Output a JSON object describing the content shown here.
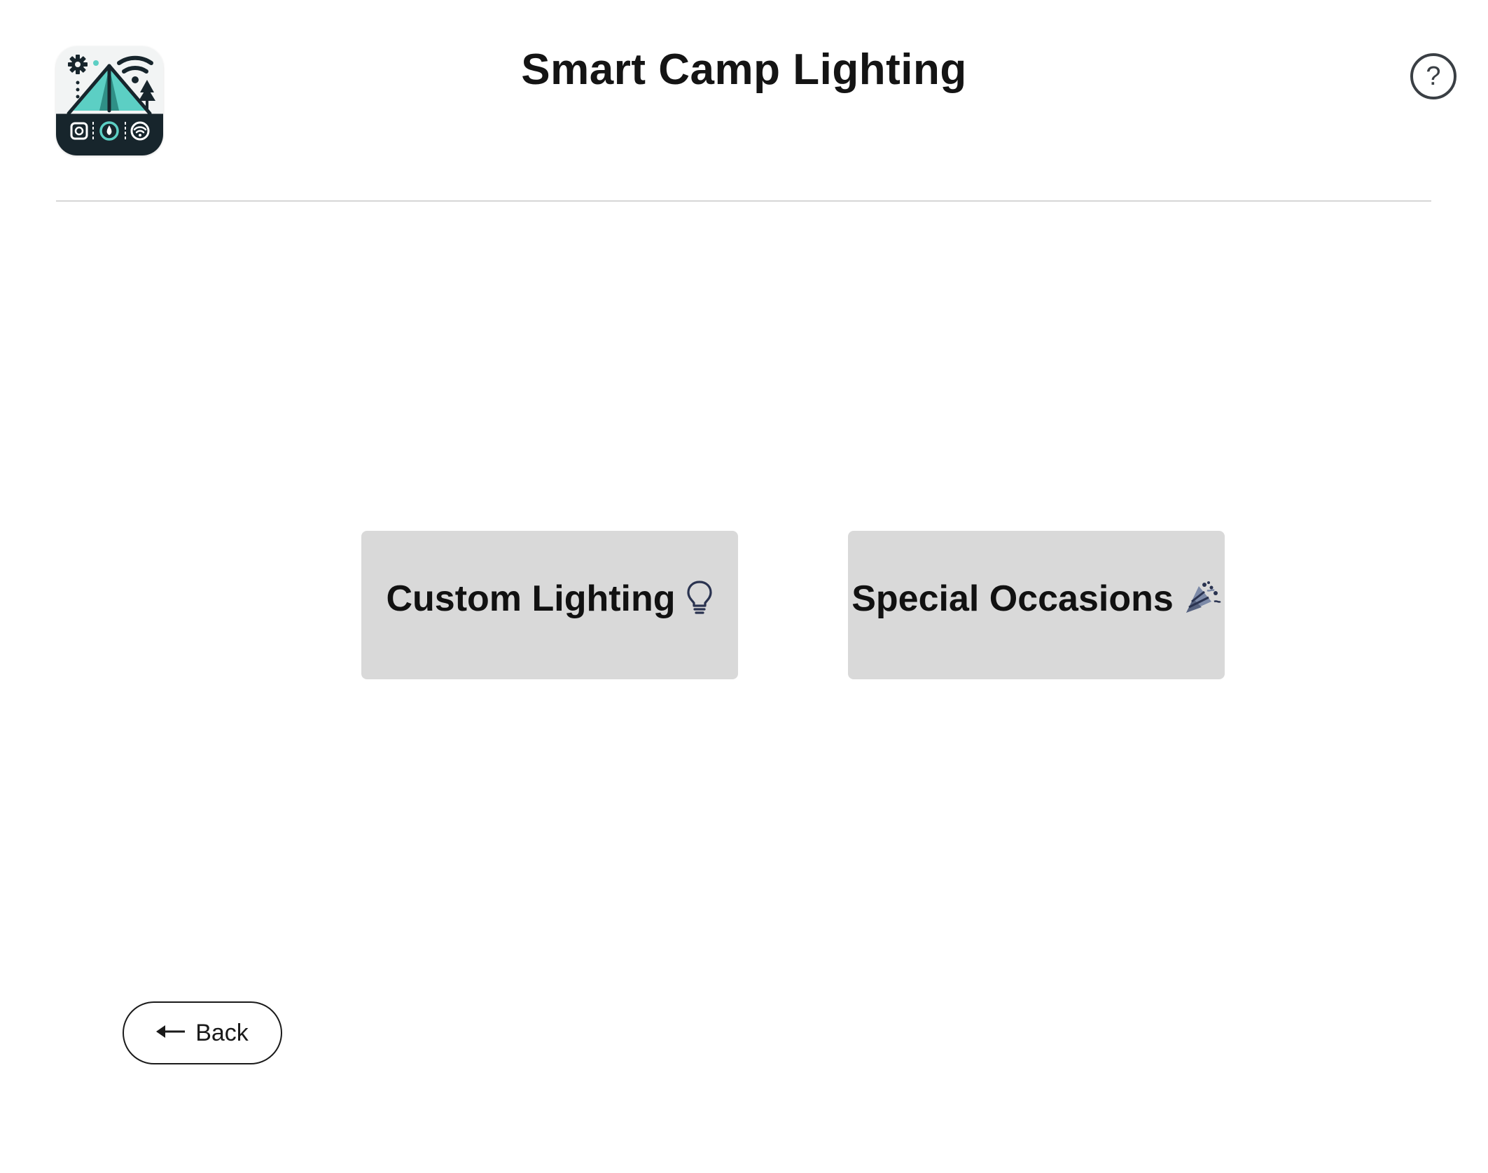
{
  "header": {
    "title": "Smart Camp Lighting",
    "help_label": "?",
    "logo_icon": "tent-smart-home-logo"
  },
  "options": [
    {
      "label": "Custom Lighting",
      "icon": "lightbulb-icon"
    },
    {
      "label": "Special Occasions",
      "icon": "party-popper-icon"
    }
  ],
  "footer": {
    "back_label": "Back",
    "back_icon": "arrow-left-icon"
  },
  "colors": {
    "card_background": "#d9d9d9",
    "logo_accent": "#5ccfc4",
    "logo_dark": "#17252c"
  }
}
